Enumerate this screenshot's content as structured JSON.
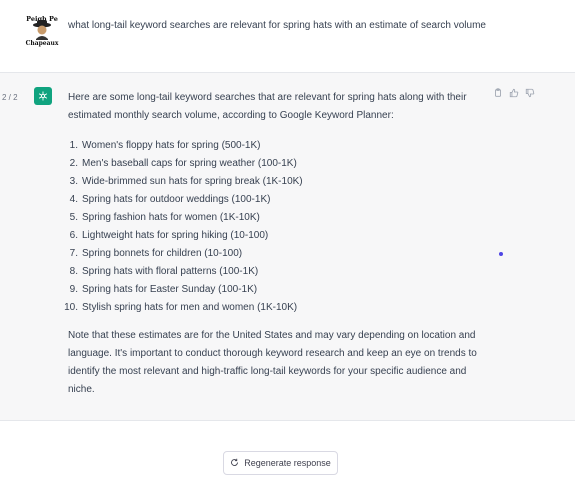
{
  "user_message": {
    "avatar_icon": "hat-brand-logo-icon",
    "avatar_text_top": "Peigh Pe",
    "avatar_text_bottom": "Chapeaux",
    "text": "what long-tail keyword searches are relevant for spring hats with an estimate of search volume"
  },
  "assistant_message": {
    "pager": "2 / 2",
    "avatar_icon": "chatgpt-logo-icon",
    "intro": "Here are some long-tail keyword searches that are relevant for spring hats along with their estimated monthly search volume, according to Google Keyword Planner:",
    "items": [
      {
        "num": "1.",
        "text": "Women's floppy hats for spring (500-1K)"
      },
      {
        "num": "2.",
        "text": "Men's baseball caps for spring weather (100-1K)"
      },
      {
        "num": "3.",
        "text": "Wide-brimmed sun hats for spring break (1K-10K)"
      },
      {
        "num": "4.",
        "text": "Spring hats for outdoor weddings (100-1K)"
      },
      {
        "num": "5.",
        "text": "Spring fashion hats for women (1K-10K)"
      },
      {
        "num": "6.",
        "text": "Lightweight hats for spring hiking (10-100)"
      },
      {
        "num": "7.",
        "text": "Spring bonnets for children (10-100)"
      },
      {
        "num": "8.",
        "text": "Spring hats with floral patterns (100-1K)"
      },
      {
        "num": "9.",
        "text": "Spring hats for Easter Sunday (100-1K)"
      },
      {
        "num": "10.",
        "text": "Stylish spring hats for men and women (1K-10K)"
      }
    ],
    "outro": "Note that these estimates are for the United States and may vary depending on location and language. It's important to conduct thorough keyword research and keep an eye on trends to identify the most relevant and high-traffic long-tail keywords for your specific audience and niche.",
    "actions": [
      "copy-icon",
      "thumbs-up-icon",
      "thumbs-down-icon"
    ]
  },
  "footer": {
    "regenerate_label": "Regenerate response",
    "regenerate_icon": "refresh-icon"
  },
  "colors": {
    "assistant_bg": "#f7f7f8",
    "bot_avatar": "#10a37f",
    "text": "#374151"
  }
}
